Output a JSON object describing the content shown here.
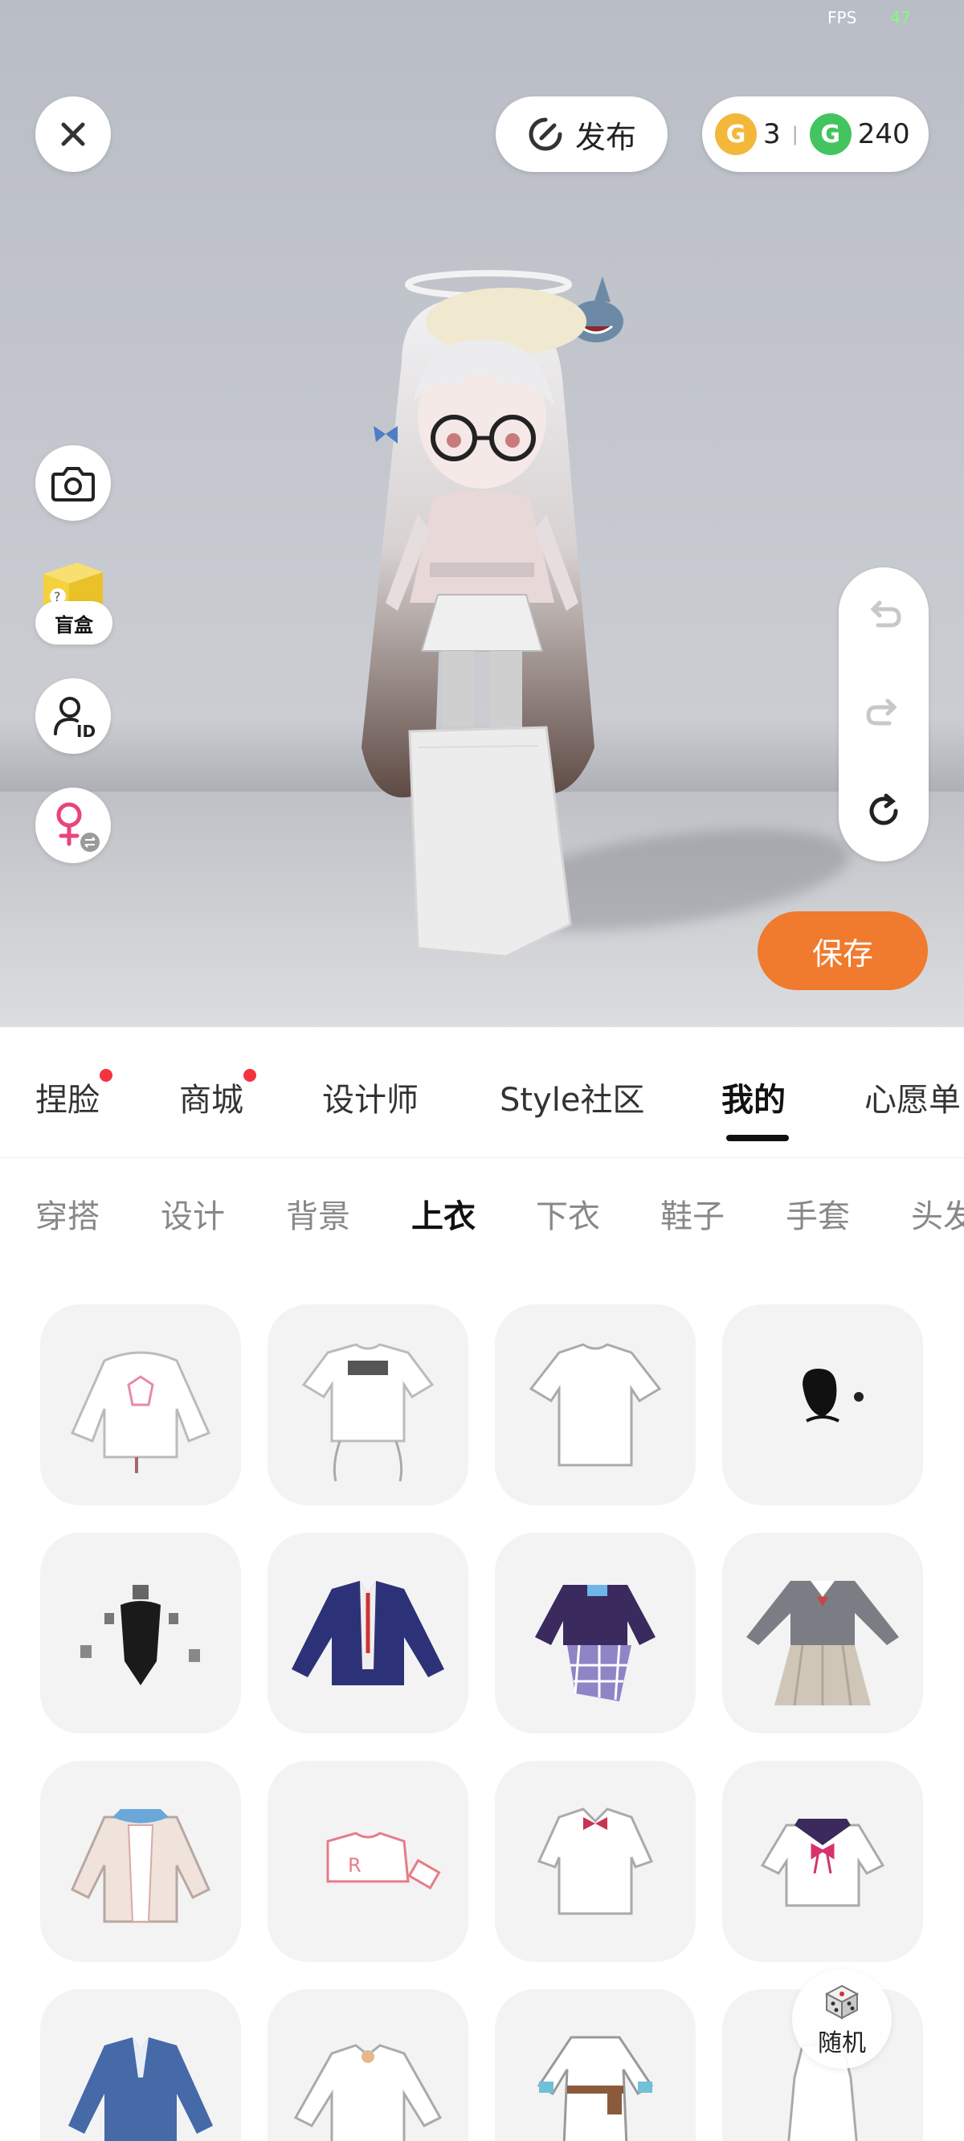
{
  "status": {
    "fps_label": "FPS",
    "fps_value": "47"
  },
  "top_bar": {
    "close_icon": "close-icon",
    "publish_label": "发布",
    "gold_coin_count": "3",
    "green_coin_count": "240",
    "gold_coin_letter": "G",
    "green_coin_letter": "G"
  },
  "side_buttons": {
    "camera_icon": "camera-icon",
    "blind_box_label": "盲盒",
    "id_icon": "user-id-icon",
    "gender_icon": "female-swap-icon"
  },
  "history": {
    "undo_icon": "undo-icon",
    "redo_icon": "redo-icon",
    "reset_icon": "reset-icon"
  },
  "save_label": "保存",
  "main_tabs": [
    {
      "label": "捏脸",
      "badge": true
    },
    {
      "label": "商城",
      "badge": true
    },
    {
      "label": "设计师",
      "badge": false
    },
    {
      "label": "Style社区",
      "badge": false
    },
    {
      "label": "我的",
      "badge": false,
      "active": true
    },
    {
      "label": "心愿单",
      "badge": false
    }
  ],
  "sub_tabs": [
    {
      "label": "穿搭"
    },
    {
      "label": "设计"
    },
    {
      "label": "背景"
    },
    {
      "label": "上衣",
      "active": true
    },
    {
      "label": "下衣"
    },
    {
      "label": "鞋子"
    },
    {
      "label": "手套"
    },
    {
      "label": "头发"
    }
  ],
  "items": [
    "white-hoodie",
    "white-tshirt-drawstring",
    "white-tshirt",
    "black-accessory",
    "black-swimsuit",
    "navy-blazer",
    "purple-plaid-dress",
    "grey-sailor-uniform",
    "cardigan-sailor",
    "pink-crop-top",
    "white-bow-shirt",
    "sailor-blouse",
    "blue-suit-jacket",
    "white-ruffle-blouse",
    "white-dress-belt",
    "white-gown"
  ],
  "random_label": "随机",
  "colors": {
    "accent": "#f07a2d",
    "badge": "#f5333f",
    "tab_active": "#111111",
    "tab_inactive": "#888888"
  }
}
